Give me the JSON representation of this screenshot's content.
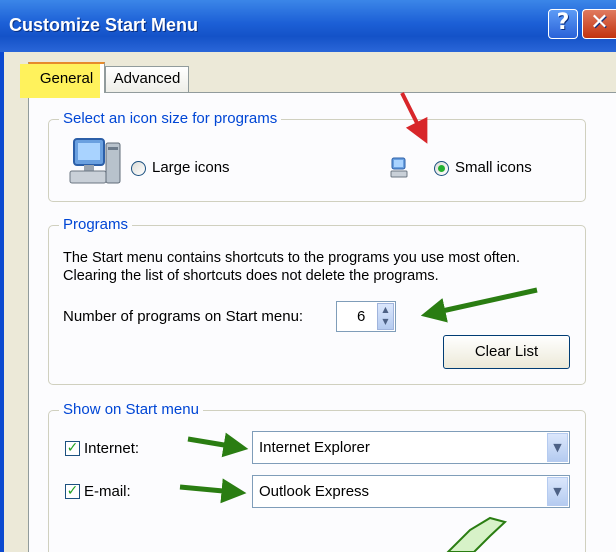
{
  "window": {
    "title": "Customize Start Menu",
    "help_glyph": "?",
    "close_glyph": "✕"
  },
  "tabs": [
    {
      "label": "General",
      "selected": true
    },
    {
      "label": "Advanced",
      "selected": false
    }
  ],
  "icon_size": {
    "legend": "Select an icon size for programs",
    "large_label": "Large icons",
    "small_label": "Small icons",
    "selected": "small"
  },
  "programs": {
    "legend": "Programs",
    "description_line1": "The Start menu contains shortcuts to the programs you use most often.",
    "description_line2": "Clearing the list of shortcuts does not delete the programs.",
    "count_label": "Number of programs on Start menu:",
    "count_value": "6",
    "clear_button": "Clear List"
  },
  "show_on_start": {
    "legend": "Show on Start menu",
    "internet_label": "Internet:",
    "internet_checked": true,
    "internet_value": "Internet Explorer",
    "email_label": "E-mail:",
    "email_checked": true,
    "email_value": "Outlook Express"
  },
  "colors": {
    "annotation_red": "#d8262a",
    "annotation_green": "#2a7d12",
    "tab_highlight": "#fff25c"
  }
}
